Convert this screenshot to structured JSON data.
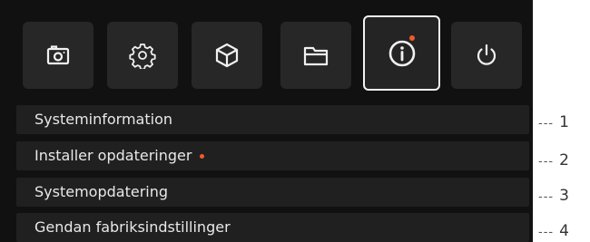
{
  "toolbar": {
    "icons": [
      "camera-icon",
      "settings-gear-icon",
      "cube-icon",
      "folder-icon",
      "info-icon",
      "power-icon"
    ],
    "active": "info-icon",
    "notification_color": "#f05a2a"
  },
  "menu": {
    "items": [
      {
        "label": "Systeminformation",
        "has_dot": false
      },
      {
        "label": "Installer opdateringer",
        "has_dot": true
      },
      {
        "label": "Systemopdatering",
        "has_dot": false
      },
      {
        "label": "Gendan fabriksindstillinger",
        "has_dot": false
      }
    ]
  },
  "callouts": {
    "dash": "---",
    "numbers": [
      "1",
      "2",
      "3",
      "4"
    ]
  }
}
